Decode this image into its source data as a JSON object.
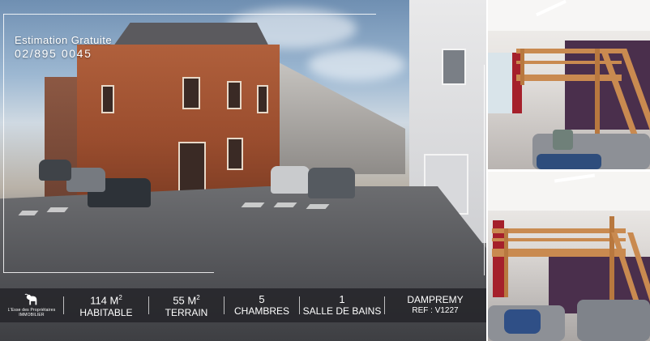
{
  "promo": {
    "line1": "Estimation Gratuite",
    "line2": "02/895 0045"
  },
  "logo": {
    "icon": "goat-icon",
    "line1": "L'Esse des Propriétaires",
    "line2": "IMMOBILIER"
  },
  "stats": [
    {
      "value": "114 M",
      "sup": "2",
      "label": "HABITABLE"
    },
    {
      "value": "55 M",
      "sup": "2",
      "label": "TERRAIN"
    },
    {
      "value": "5",
      "sup": "",
      "label": "CHAMBRES"
    },
    {
      "value": "1",
      "sup": "",
      "label": "SALLE DE BAINS"
    }
  ],
  "location": {
    "city": "DAMPREMY",
    "ref": "REF : V1227"
  },
  "colors": {
    "bar_bg": "#26262a",
    "text": "#ffffff",
    "loft_wood": "#c98a50",
    "wall_purple": "#4a2f4c"
  }
}
